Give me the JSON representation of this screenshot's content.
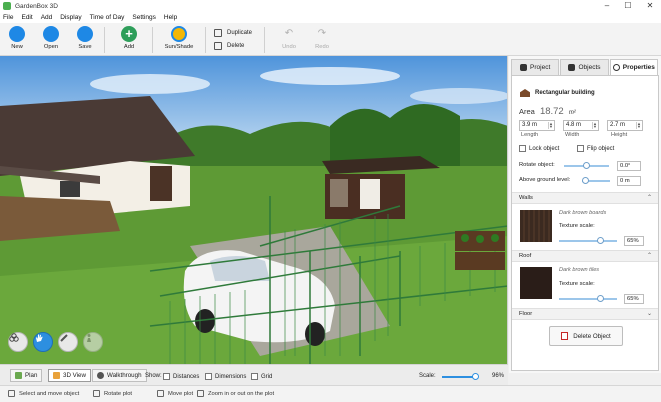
{
  "window": {
    "title": "GardenBox 3D"
  },
  "menu": [
    "File",
    "Edit",
    "Add",
    "Display",
    "Time of Day",
    "Settings",
    "Help"
  ],
  "toolbar": {
    "new": "New",
    "open": "Open",
    "save": "Save",
    "add": "Add",
    "sun_shade": "Sun/Shade",
    "duplicate": "Duplicate",
    "delete": "Delete",
    "undo": "Undo",
    "redo": "Redo"
  },
  "panel": {
    "tabs": [
      "Project",
      "Objects",
      "Properties"
    ],
    "active_tab": "Properties",
    "object_title": "Rectangular building",
    "area_label": "Area",
    "area_value": "18.72",
    "area_unit": "m²",
    "length": "3.9 m",
    "width": "4.8 m",
    "height": "2.7 m",
    "length_label": "Length",
    "width_label": "Width",
    "height_label": "Height",
    "lock_object": "Lock object",
    "flip_object": "Flip object",
    "rotate_label": "Rotate object:",
    "rotate_value": "0.0°",
    "above_ground_label": "Above ground level:",
    "above_ground_value": "0 m",
    "walls_section": "Walls",
    "walls_texture": "Dark brown boards",
    "texture_scale_label": "Texture scale:",
    "walls_scale": "65%",
    "roof_section": "Roof",
    "roof_texture": "Dark brown tiles",
    "roof_scale": "65%",
    "floor_section": "Floor",
    "delete_object": "Delete Object"
  },
  "viewbar": {
    "plan": "Plan",
    "view3d": "3D View",
    "walkthrough": "Walkthrough",
    "show_label": "Show:",
    "distances": "Distances",
    "dimensions": "Dimensions",
    "grid": "Grid",
    "scale_label": "Scale:",
    "scale_value": "96%"
  },
  "status": {
    "select": "Select and move object",
    "rotate": "Rotate plot",
    "move": "Move plot",
    "zoom": "Zoom in or out on the plot"
  },
  "colors": {
    "accent": "#2d8fe0",
    "toolbar_blue": "#1e88e5",
    "add_green": "#2e9e5a",
    "sun_yellow": "#f2b705",
    "grass": "#4f8a2d",
    "sky": "#8fbde8"
  },
  "icons": {
    "nav_layers": "layers-icon",
    "nav_hand": "hand-icon",
    "nav_ruler": "ruler-icon",
    "nav_person": "person-icon"
  }
}
